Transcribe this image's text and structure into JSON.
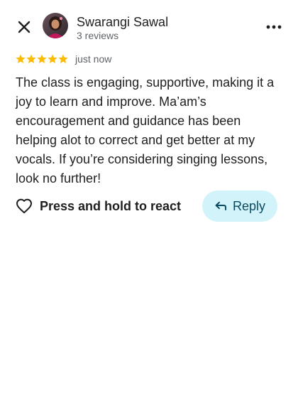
{
  "header": {
    "close_icon": "close-icon",
    "author_name": "Swarangi Sawal",
    "review_count": "3 reviews",
    "more_icon": "more-vertical-icon"
  },
  "review": {
    "rating": 5,
    "max_rating": 5,
    "time": "just now",
    "text": "The class is engaging, supportive, making it a joy to learn and improve. Ma’am’s encouragement and guidance has been helping alot to correct and get better at my vocals. If you’re considering singing lessons, look no further!"
  },
  "actions": {
    "react_icon": "heart-outline-icon",
    "react_label": "Press and hold to react",
    "reply_icon": "reply-arrow-icon",
    "reply_label": "Reply"
  },
  "colors": {
    "star": "#fbbc04",
    "reply_background": "#d3f3fb",
    "reply_text": "#0b4a5e",
    "secondary_text": "#5f6368"
  }
}
